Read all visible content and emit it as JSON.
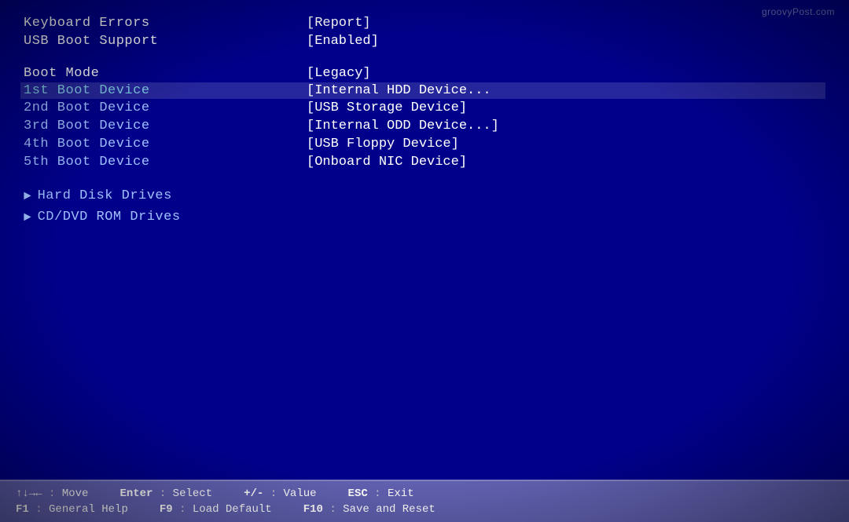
{
  "watermark": "groovyPost.com",
  "rows": [
    {
      "label": "Keyboard Errors",
      "value": "[Report]",
      "labelStyle": "white",
      "valueStyle": ""
    },
    {
      "label": "USB Boot Support",
      "value": "[Enabled]",
      "labelStyle": "white",
      "valueStyle": ""
    }
  ],
  "section_gap": true,
  "boot_mode": {
    "label": "Boot Mode",
    "value": "[Legacy]",
    "labelStyle": "white"
  },
  "boot_devices": [
    {
      "label": "1st Boot Device",
      "value": "[Internal HDD Device...",
      "selected": true
    },
    {
      "label": "2nd Boot Device",
      "value": "[USB Storage Device]",
      "selected": false
    },
    {
      "label": "3rd Boot Device",
      "value": "[Internal ODD Device...]",
      "selected": false
    },
    {
      "label": "4th Boot Device",
      "value": "[USB Floppy Device]",
      "selected": false
    },
    {
      "label": "5th Boot Device",
      "value": "[Onboard NIC Device]",
      "selected": false
    }
  ],
  "submenu_items": [
    {
      "label": "Hard Disk Drives"
    },
    {
      "label": "CD/DVD ROM Drives"
    }
  ],
  "status_bar": {
    "row1": [
      {
        "key": "↑↓→←",
        "sep": ":",
        "desc": "Move"
      },
      {
        "key": "Enter",
        "sep": ":",
        "desc": "Select"
      },
      {
        "key": "+/-",
        "sep": ":",
        "desc": "Value"
      },
      {
        "key": "ESC",
        "sep": ":",
        "desc": "Exit"
      }
    ],
    "row2": [
      {
        "key": "F1",
        "sep": ":",
        "desc": "General Help"
      },
      {
        "key": "F9",
        "sep": ":",
        "desc": "Load Default"
      },
      {
        "key": "F10",
        "sep": ":",
        "desc": "Save and Reset"
      }
    ]
  }
}
